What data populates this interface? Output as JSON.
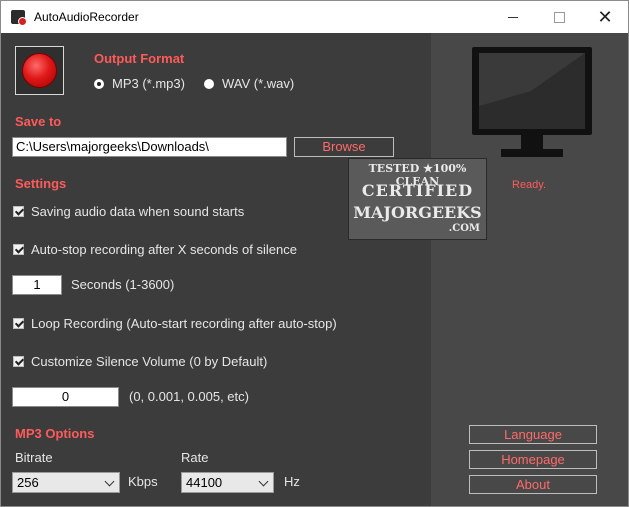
{
  "window": {
    "title": "AutoAudioRecorder"
  },
  "output_format": {
    "heading": "Output Format",
    "options": [
      {
        "label": "MP3 (*.mp3)",
        "checked": true
      },
      {
        "label": "WAV (*.wav)",
        "checked": false
      }
    ]
  },
  "save_to": {
    "heading": "Save to",
    "path": "C:\\Users\\majorgeeks\\Downloads\\",
    "browse_label": "Browse"
  },
  "settings": {
    "heading": "Settings",
    "saving_on_sound": {
      "label": "Saving audio data when sound starts",
      "checked": true
    },
    "auto_stop": {
      "label": "Auto-stop recording after X seconds of silence",
      "checked": true
    },
    "seconds_value": "1",
    "seconds_label": "Seconds (1-3600)",
    "loop": {
      "label": "Loop Recording (Auto-start recording after auto-stop)",
      "checked": true
    },
    "silence": {
      "label": "Customize Silence Volume (0 by Default)",
      "checked": true
    },
    "silence_value": "0",
    "silence_hint": "(0, 0.001, 0.005, etc)"
  },
  "mp3_options": {
    "heading": "MP3 Options",
    "bitrate_label": "Bitrate",
    "bitrate_value": "256",
    "bitrate_unit": "Kbps",
    "rate_label": "Rate",
    "rate_value": "44100",
    "rate_unit": "Hz"
  },
  "side": {
    "status": "Ready.",
    "language_label": "Language",
    "homepage_label": "Homepage",
    "about_label": "About"
  },
  "watermark": {
    "line1": "TESTED ★100% CLEAN",
    "line2": "CERTIFIED",
    "line3": "MAJORGEEKS",
    "line4": ".COM"
  },
  "colors": {
    "accent": "#ff5a5a",
    "panel": "#3c3c3c",
    "side_panel": "#484848"
  }
}
